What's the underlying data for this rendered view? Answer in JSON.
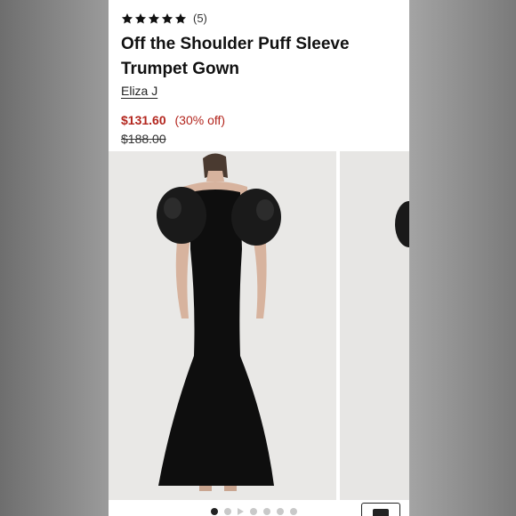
{
  "product": {
    "rating_count": "(5)",
    "title": "Off the Shoulder Puff Sleeve Trumpet Gown",
    "brand": "Eliza J",
    "sale_price": "$131.60",
    "discount": "(30% off)",
    "original_price": "$188.00"
  },
  "rating": {
    "stars_filled": 5,
    "stars_total": 5
  },
  "gallery": {
    "dot_count": 7,
    "active_index": 0,
    "video_index": 2
  },
  "colors": {
    "sale": "#b3261e",
    "star": "#111111",
    "dress": "#0e0e0e",
    "backdrop": "#e9e8e6"
  },
  "icons": [
    "star-icon",
    "play-icon",
    "bag-icon"
  ]
}
